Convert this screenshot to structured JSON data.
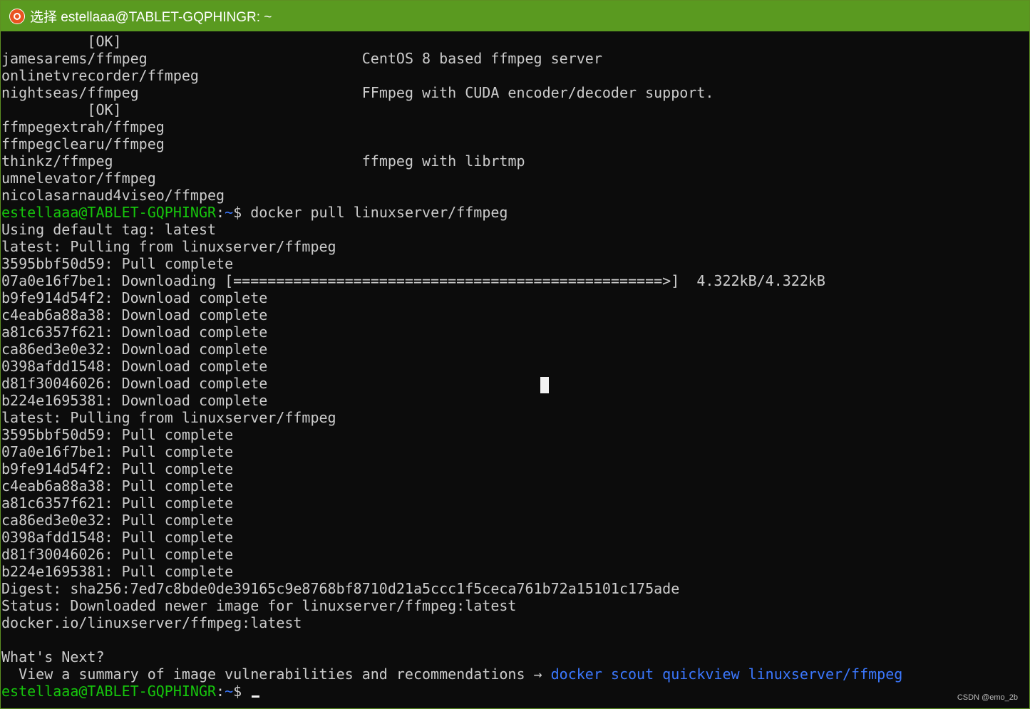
{
  "window": {
    "title": "选择 estellaaa@TABLET-GQPHINGR: ~",
    "icon": "ubuntu-icon",
    "accent_color": "#5a9a20"
  },
  "terminal": {
    "search_results": [
      {
        "name": "",
        "description": "",
        "status": "[OK]"
      },
      {
        "name": "jamesarems/ffmpeg",
        "description": "CentOS 8 based ffmpeg server",
        "status": ""
      },
      {
        "name": "onlinetvrecorder/ffmpeg",
        "description": "",
        "status": ""
      },
      {
        "name": "nightseas/ffmpeg",
        "description": "FFmpeg with CUDA encoder/decoder support.",
        "status": ""
      },
      {
        "name": "",
        "description": "",
        "status": "[OK]"
      },
      {
        "name": "ffmpegextrah/ffmpeg",
        "description": "",
        "status": ""
      },
      {
        "name": "ffmpegclearu/ffmpeg",
        "description": "",
        "status": ""
      },
      {
        "name": "thinkz/ffmpeg",
        "description": "ffmpeg with librtmp",
        "status": ""
      },
      {
        "name": "umnelevator/ffmpeg",
        "description": "",
        "status": ""
      },
      {
        "name": "nicolasarnaud4viseo/ffmpeg",
        "description": "",
        "status": ""
      }
    ],
    "prompt_user_host": "estellaaa@TABLET-GQPHINGR",
    "prompt_path": "~",
    "prompt_symbol": "$",
    "command": "docker pull linuxserver/ffmpeg",
    "output_lines": [
      "Using default tag: latest",
      "latest: Pulling from linuxserver/ffmpeg",
      "3595bbf50d59: Pull complete",
      "07a0e16f7be1: Downloading [==================================================>]  4.322kB/4.322kB",
      "b9fe914d54f2: Download complete",
      "c4eab6a88a38: Download complete",
      "a81c6357f621: Download complete",
      "ca86ed3e0e32: Download complete",
      "0398afdd1548: Download complete",
      "d81f30046026: Download complete",
      "b224e1695381: Download complete",
      "latest: Pulling from linuxserver/ffmpeg",
      "3595bbf50d59: Pull complete",
      "07a0e16f7be1: Pull complete",
      "b9fe914d54f2: Pull complete",
      "c4eab6a88a38: Pull complete",
      "a81c6357f621: Pull complete",
      "ca86ed3e0e32: Pull complete",
      "0398afdd1548: Pull complete",
      "d81f30046026: Pull complete",
      "b224e1695381: Pull complete",
      "Digest: sha256:7ed7c8bde0de39165c9e8768bf8710d21a5ccc1f5ceca761b72a15101c175ade",
      "Status: Downloaded newer image for linuxserver/ffmpeg:latest",
      "docker.io/linuxserver/ffmpeg:latest",
      "",
      "What's Next?"
    ],
    "next_hint": {
      "text": "  View a summary of image vulnerabilities and recommendations → ",
      "command": "docker scout quickview linuxserver/ffmpeg"
    },
    "colors": {
      "prompt": "#16c60c",
      "link": "#3b78ff",
      "text": "#cccccc",
      "background": "#0c0c0c"
    }
  },
  "watermark": "CSDN @emo_2b"
}
